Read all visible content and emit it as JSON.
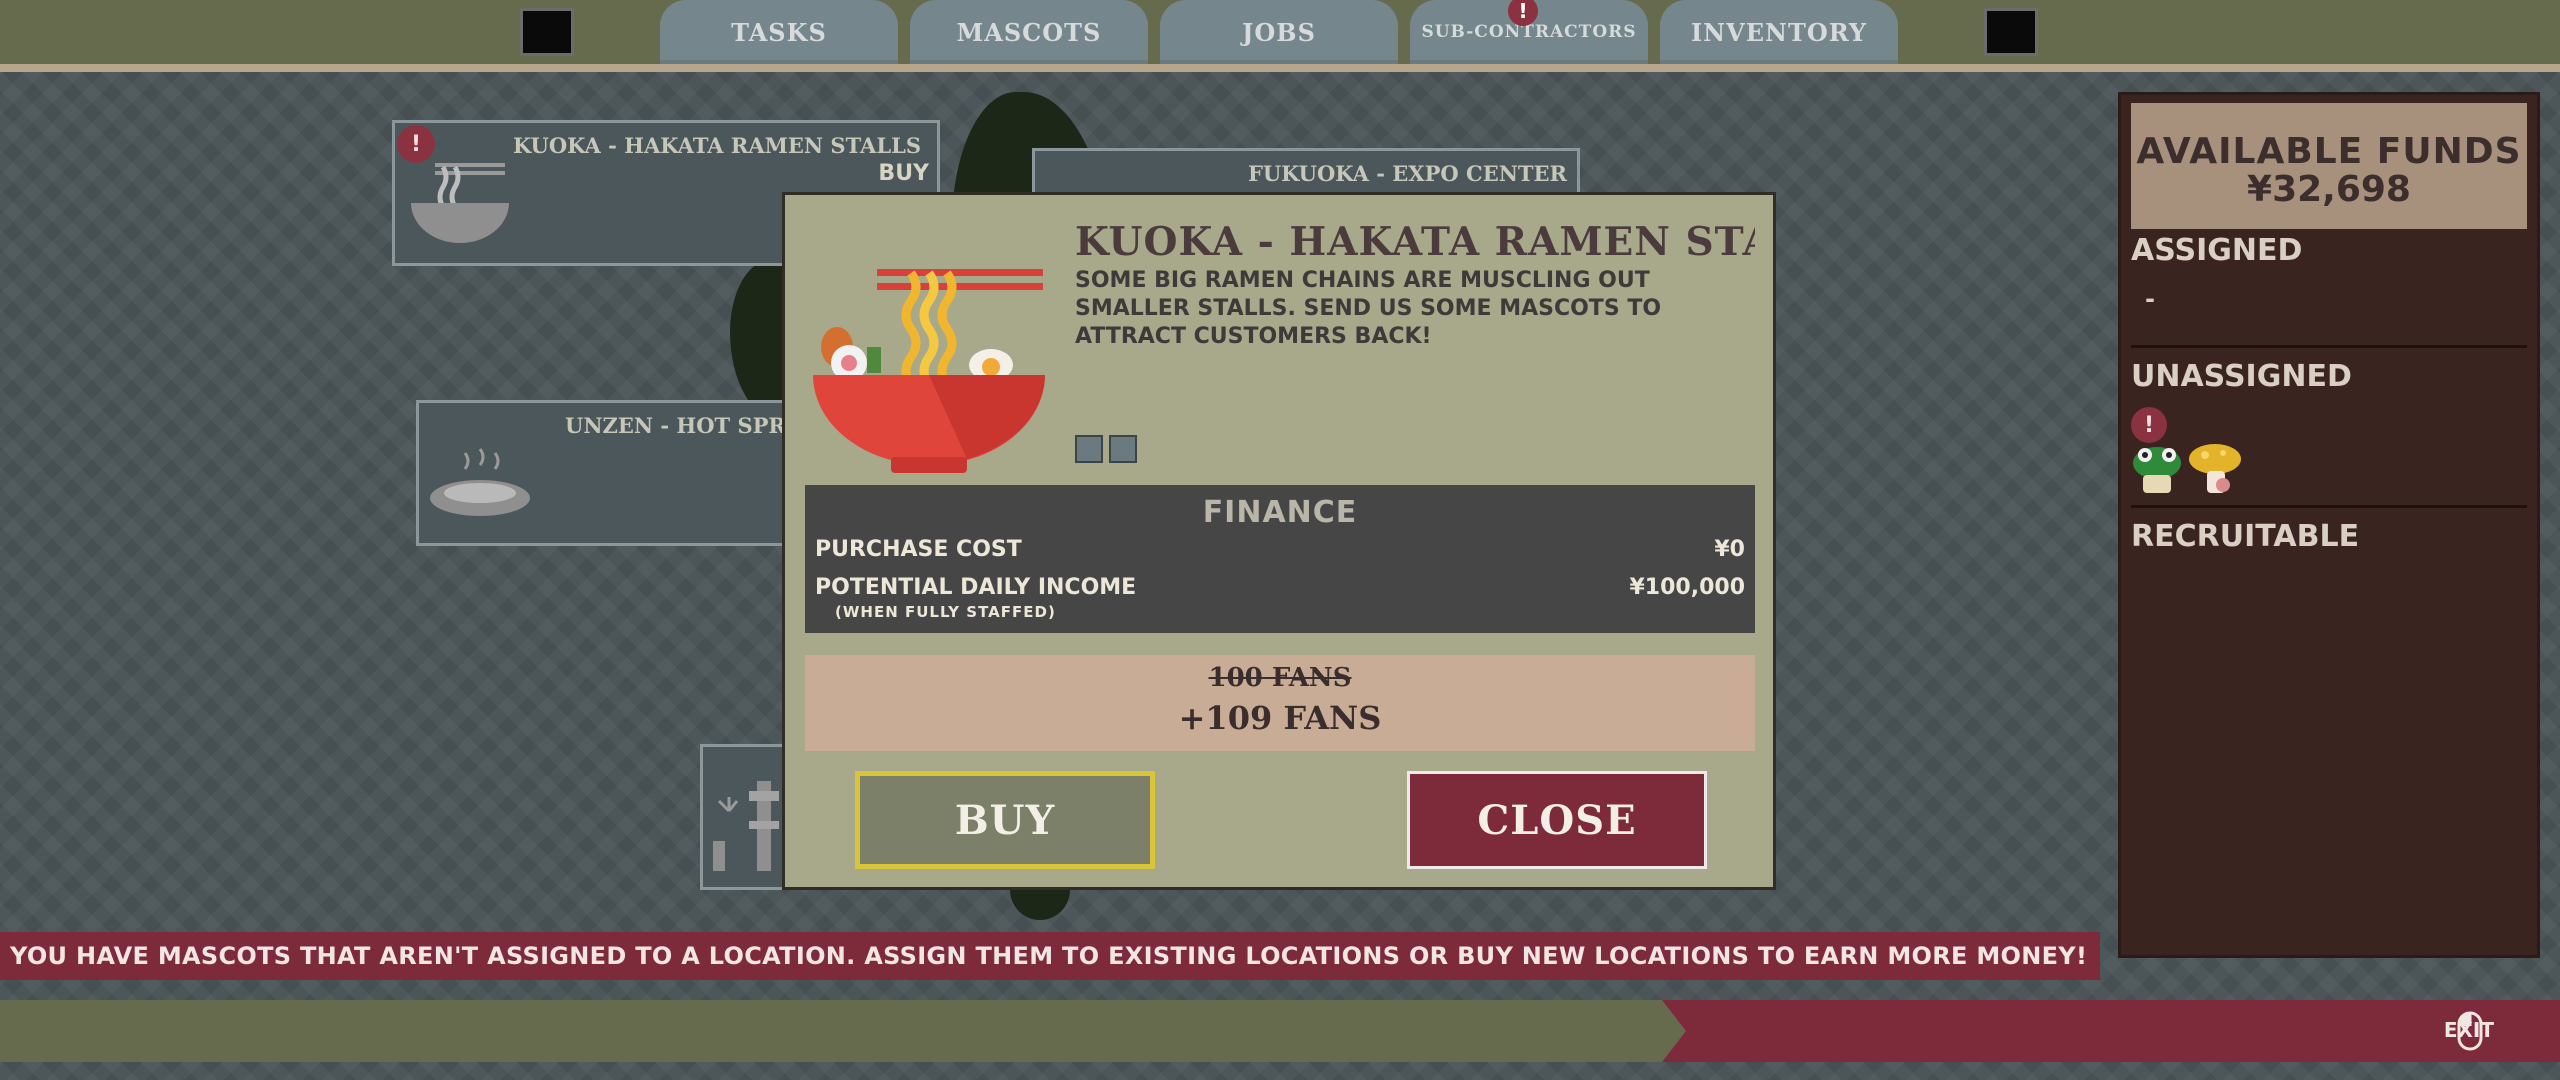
{
  "tabs": [
    {
      "label": "TASKS"
    },
    {
      "label": "MASCOTS"
    },
    {
      "label": "JOBS"
    },
    {
      "label": "SUB-CONTRACTORS",
      "badge": "!"
    },
    {
      "label": "INVENTORY"
    }
  ],
  "map": {
    "cards": [
      {
        "title": "KUOKA - HAKATA RAMEN STALLS",
        "action": "BUY",
        "badge": "!"
      },
      {
        "title": "FUKUOKA - EXPO CENTER"
      },
      {
        "title": "UNZEN - HOT SPR"
      }
    ]
  },
  "modal": {
    "title": "KUOKA - HAKATA RAMEN STA",
    "description": "SOME BIG RAMEN CHAINS ARE MUSCLING OUT SMALLER STALLS. SEND US SOME MASCOTS TO ATTRACT CUSTOMERS BACK!",
    "finance": {
      "heading": "FINANCE",
      "purchase_label": "PURCHASE COST",
      "purchase_value": "¥0",
      "income_label": "POTENTIAL DAILY INCOME",
      "income_note": "(WHEN FULLY STAFFED)",
      "income_value": "¥100,000"
    },
    "fans_old": "100 FANS",
    "fans_new": "+109 FANS",
    "buy_label": "BUY",
    "close_label": "CLOSE"
  },
  "panel": {
    "funds_label": "AVAILABLE FUNDS",
    "funds_value": "¥32,698",
    "assigned_label": "ASSIGNED",
    "assigned_value": "-",
    "unassigned_label": "UNASSIGNED",
    "unassigned_badge": "!",
    "recruitable_label": "RECRUITABLE"
  },
  "message": "YOU HAVE MASCOTS THAT AREN'T ASSIGNED TO A LOCATION. ASSIGN THEM TO EXISTING LOCATIONS OR BUY NEW LOCATIONS TO EARN MORE MONEY!",
  "footer": {
    "exit_label": "EXIT",
    "exit_icon": "mouse-icon"
  },
  "colors": {
    "accent_red": "#7d2b3b",
    "panel_brown": "#3a2420",
    "modal_bg": "#a8a88a",
    "buy_border": "#d8c53a"
  }
}
